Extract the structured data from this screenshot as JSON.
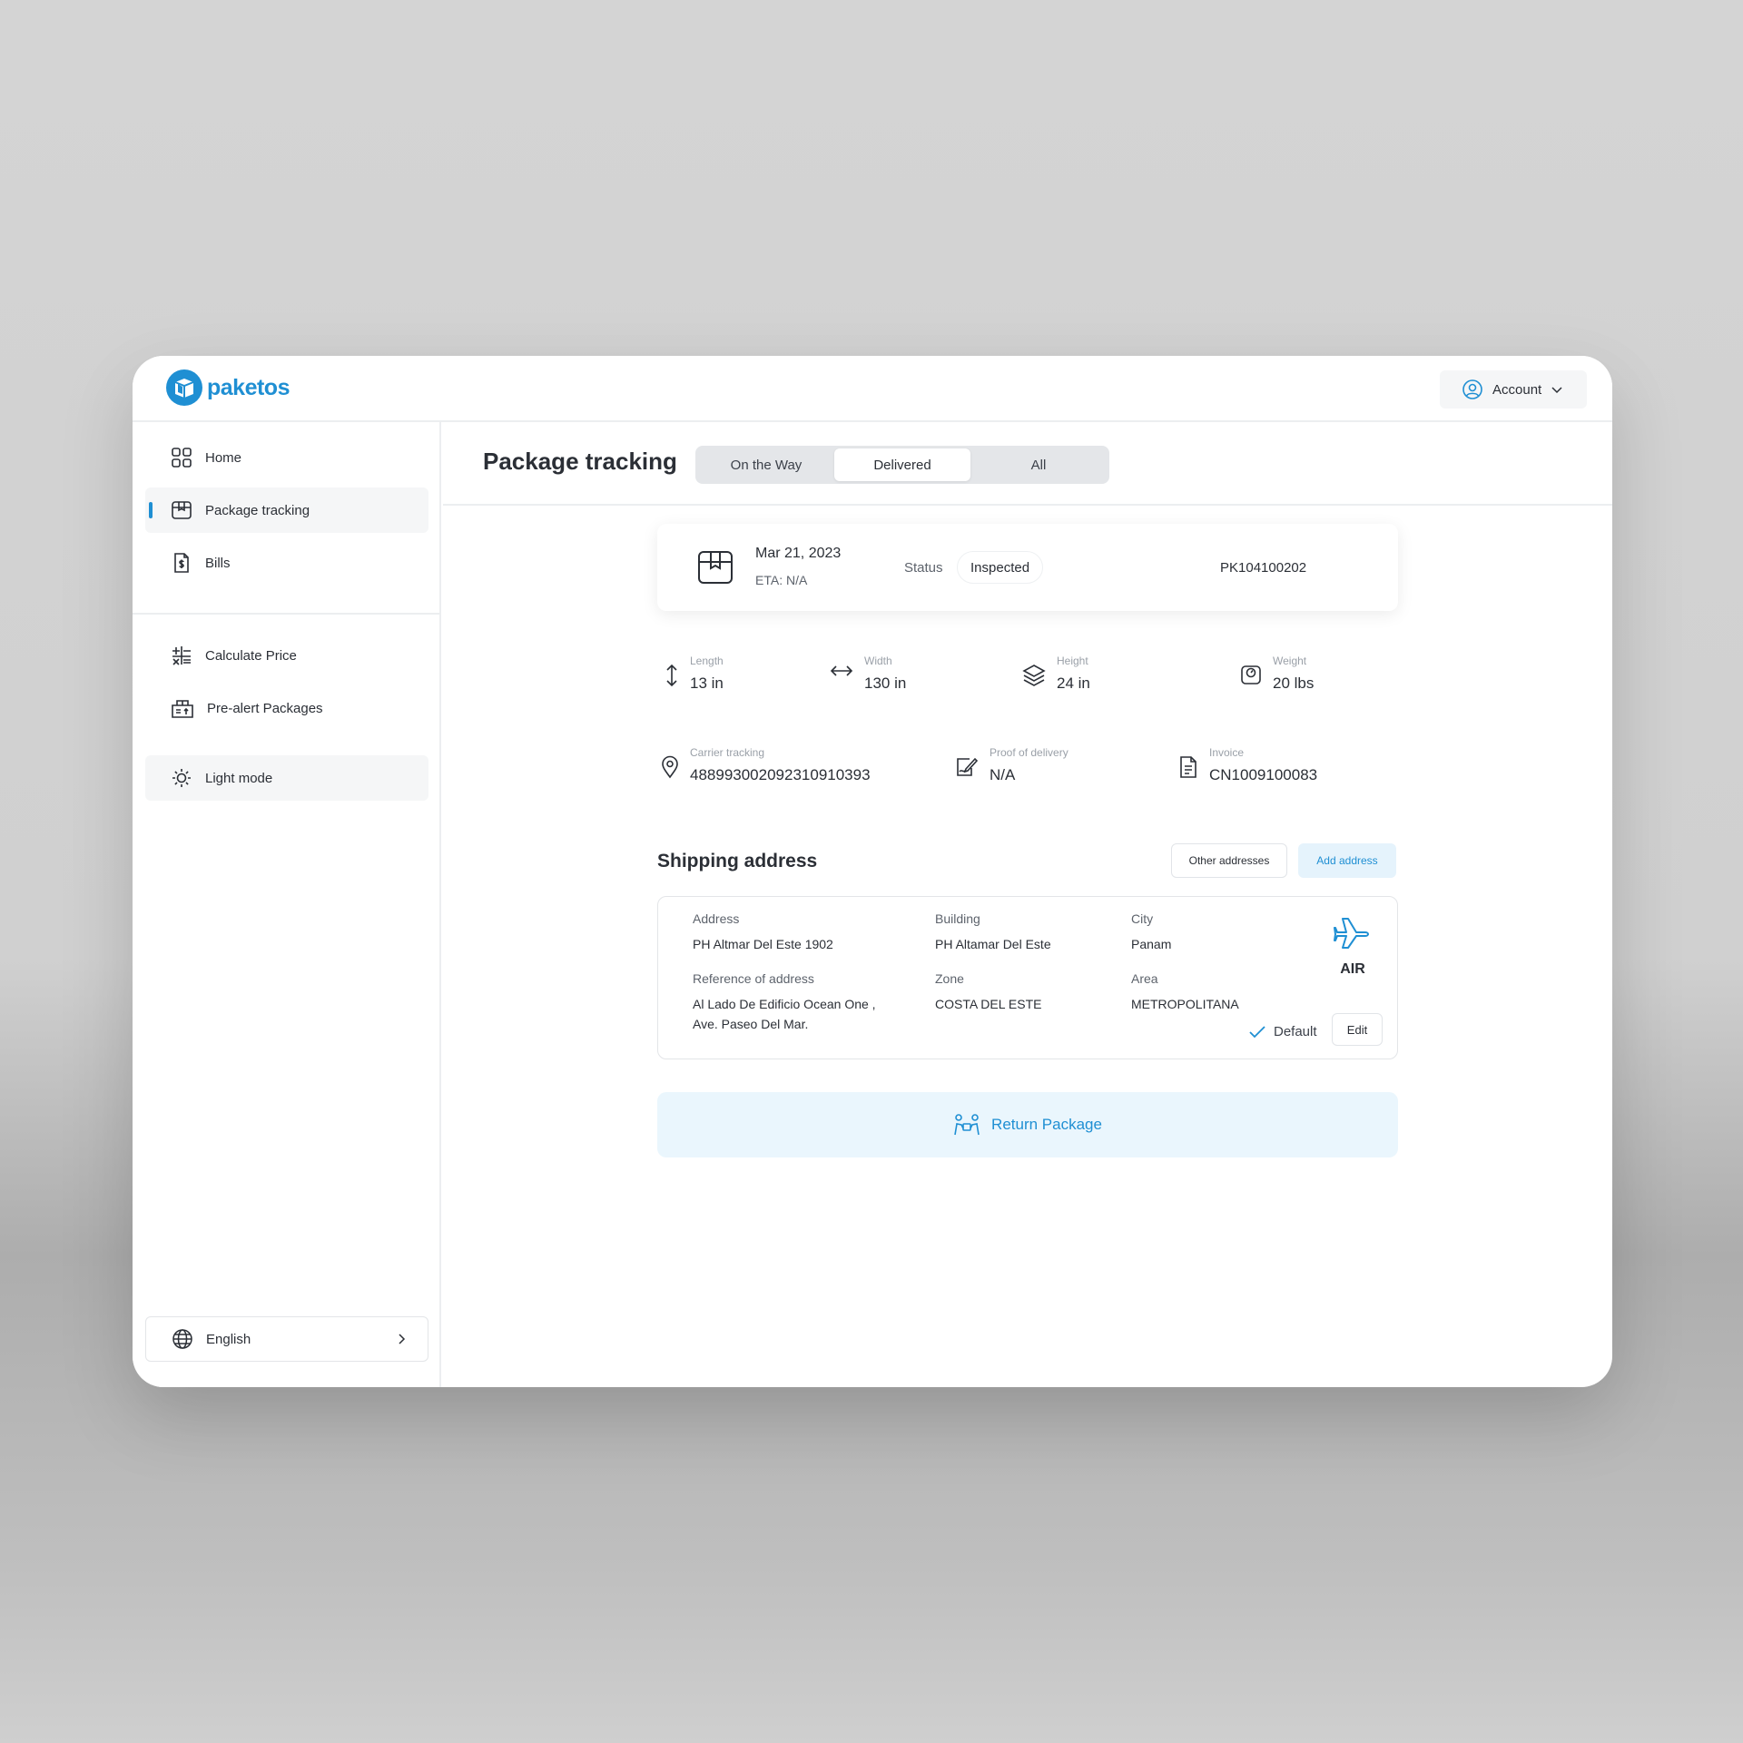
{
  "colors": {
    "accent": "#1f8fd3",
    "accent_bg": "#eaf6fd",
    "text": "#2b2f36",
    "muted": "#5d636c"
  },
  "brand": {
    "name": "paketos"
  },
  "header": {
    "account_label": "Account"
  },
  "sidebar": {
    "items": [
      {
        "label": "Home",
        "icon": "grid-icon"
      },
      {
        "label": "Package tracking",
        "icon": "box-icon",
        "active": true
      },
      {
        "label": "Bills",
        "icon": "bill-icon"
      },
      {
        "label": "Calculate Price",
        "icon": "calculator-icon"
      },
      {
        "label": "Pre-alert Packages",
        "icon": "pre-alert-icon"
      },
      {
        "label": "Light mode",
        "icon": "sun-icon"
      }
    ],
    "language": "English"
  },
  "main": {
    "title": "Package tracking",
    "tabs": [
      {
        "label": "On the Way"
      },
      {
        "label": "Delivered",
        "active": true
      },
      {
        "label": "All"
      }
    ]
  },
  "package": {
    "date": "Mar 21, 2023",
    "eta": "ETA: N/A",
    "status_label": "Status",
    "status": "Inspected",
    "id": "PK104100202"
  },
  "dimensions": [
    {
      "label": "Length",
      "value": "13 in",
      "icon": "vertical-arrow-icon"
    },
    {
      "label": "Width",
      "value": "130 in",
      "icon": "horizontal-arrow-icon"
    },
    {
      "label": "Height",
      "value": "24 in",
      "icon": "layers-icon"
    },
    {
      "label": "Weight",
      "value": "20 lbs",
      "icon": "scale-icon"
    }
  ],
  "tracking": [
    {
      "label": "Carrier tracking",
      "value": "488993002092310910393",
      "icon": "location-pin-icon"
    },
    {
      "label": "Proof of delivery",
      "value": "N/A",
      "icon": "signature-icon"
    },
    {
      "label": "Invoice",
      "value": "CN1009100083",
      "icon": "document-icon"
    }
  ],
  "shipping": {
    "title": "Shipping address",
    "other_button": "Other addresses",
    "add_button": "Add address",
    "fields": [
      {
        "label": "Address",
        "value": "PH Altmar Del Este 1902"
      },
      {
        "label": "Building",
        "value": "PH Altamar Del Este"
      },
      {
        "label": "City",
        "value": "Panam"
      },
      {
        "label": "Reference of address",
        "value": "Al Lado De Edificio Ocean One , Ave. Paseo Del Mar."
      },
      {
        "label": "Zone",
        "value": "COSTA DEL ESTE"
      },
      {
        "label": "Area",
        "value": "METROPOLITANA"
      }
    ],
    "mode": "AIR",
    "default_label": "Default",
    "edit_label": "Edit"
  },
  "return_button": "Return Package"
}
